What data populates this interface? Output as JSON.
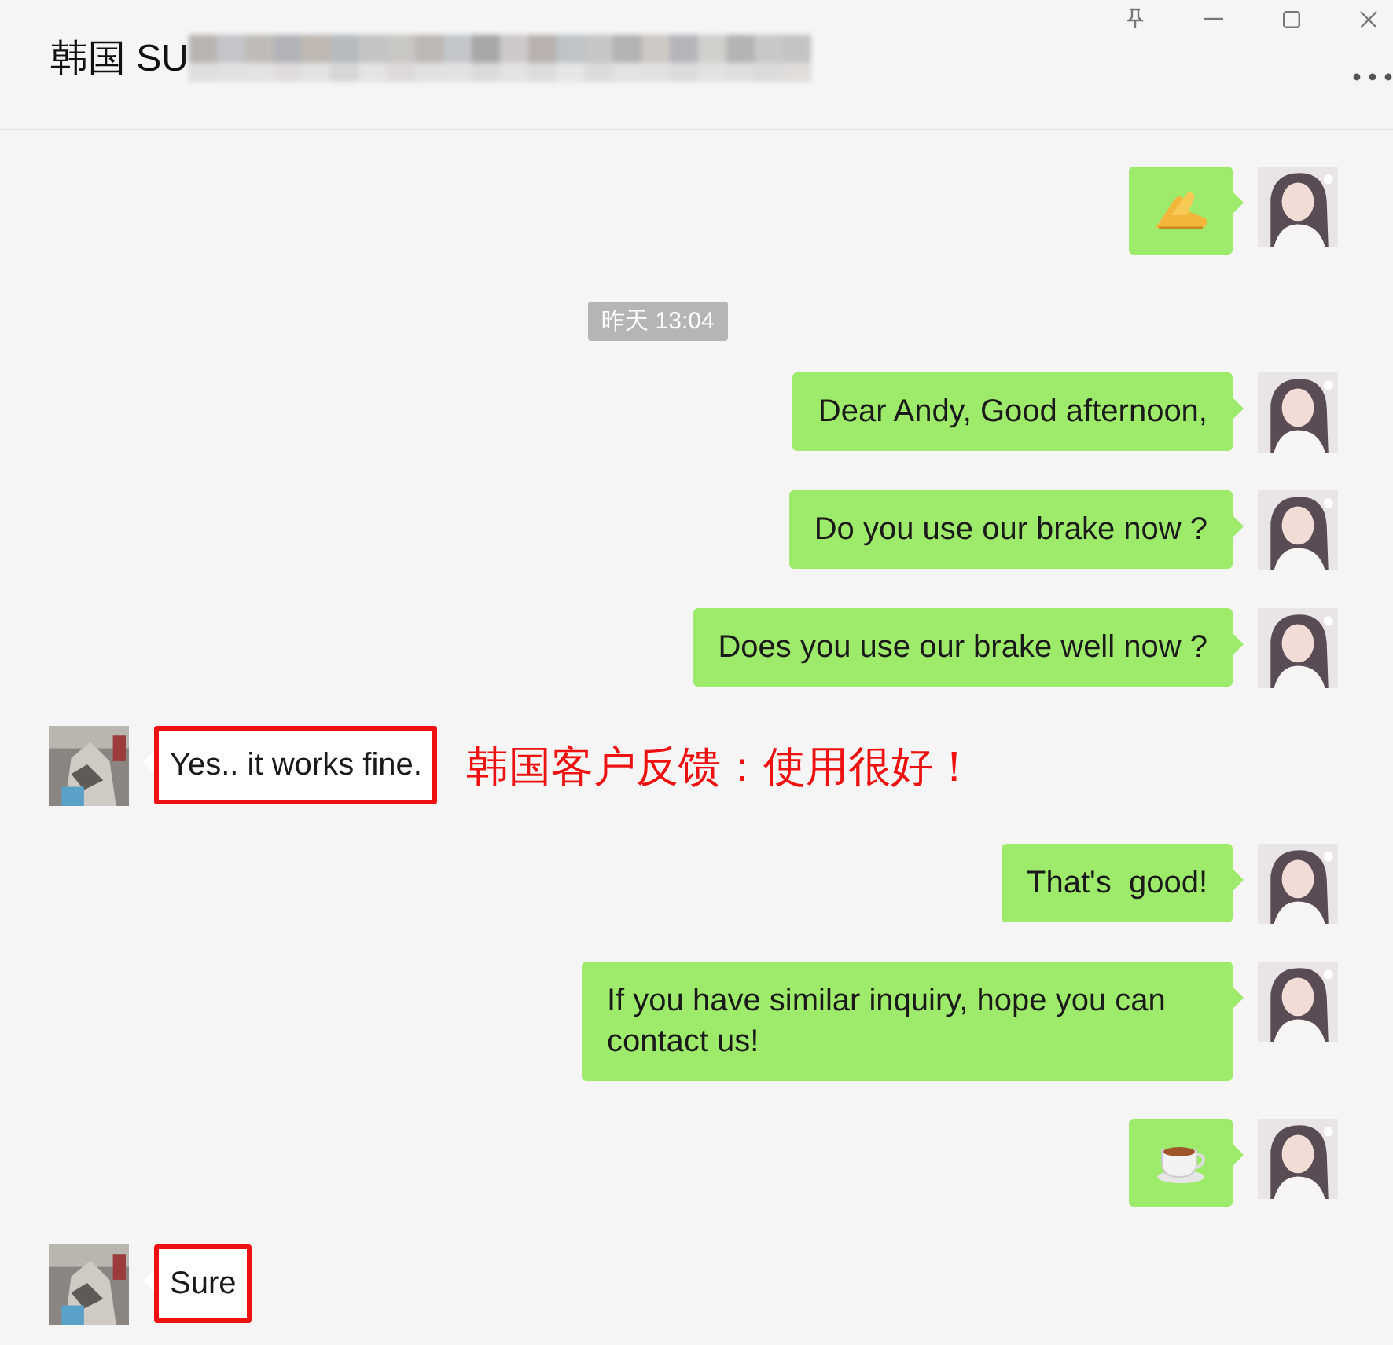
{
  "window": {
    "title": "韩国 SU",
    "title_redacted": true
  },
  "messages": [
    {
      "kind": "handsticker",
      "outgoing": true
    },
    {
      "kind": "time",
      "text": "昨天 13:04"
    },
    {
      "kind": "text",
      "outgoing": true,
      "text": "Dear Andy, Good afternoon,",
      "highlighted": false
    },
    {
      "kind": "text",
      "outgoing": true,
      "text": "Do you use our brake now ?",
      "highlighted": false
    },
    {
      "kind": "text",
      "outgoing": true,
      "text": "Does you use our brake well now ?",
      "highlighted": false
    },
    {
      "kind": "text",
      "outgoing": false,
      "text": "Yes.. it works fine.",
      "highlighted": true,
      "annotation": "韩国客户反馈：使用很好！"
    },
    {
      "kind": "text",
      "outgoing": true,
      "text": "That's  good!",
      "highlighted": false
    },
    {
      "kind": "text",
      "outgoing": true,
      "text": "If you have similar inquiry, hope you can contact us!",
      "highlighted": false
    },
    {
      "kind": "cupsticker",
      "outgoing": true
    },
    {
      "kind": "text",
      "outgoing": false,
      "text": "Sure",
      "highlighted": true
    }
  ]
}
